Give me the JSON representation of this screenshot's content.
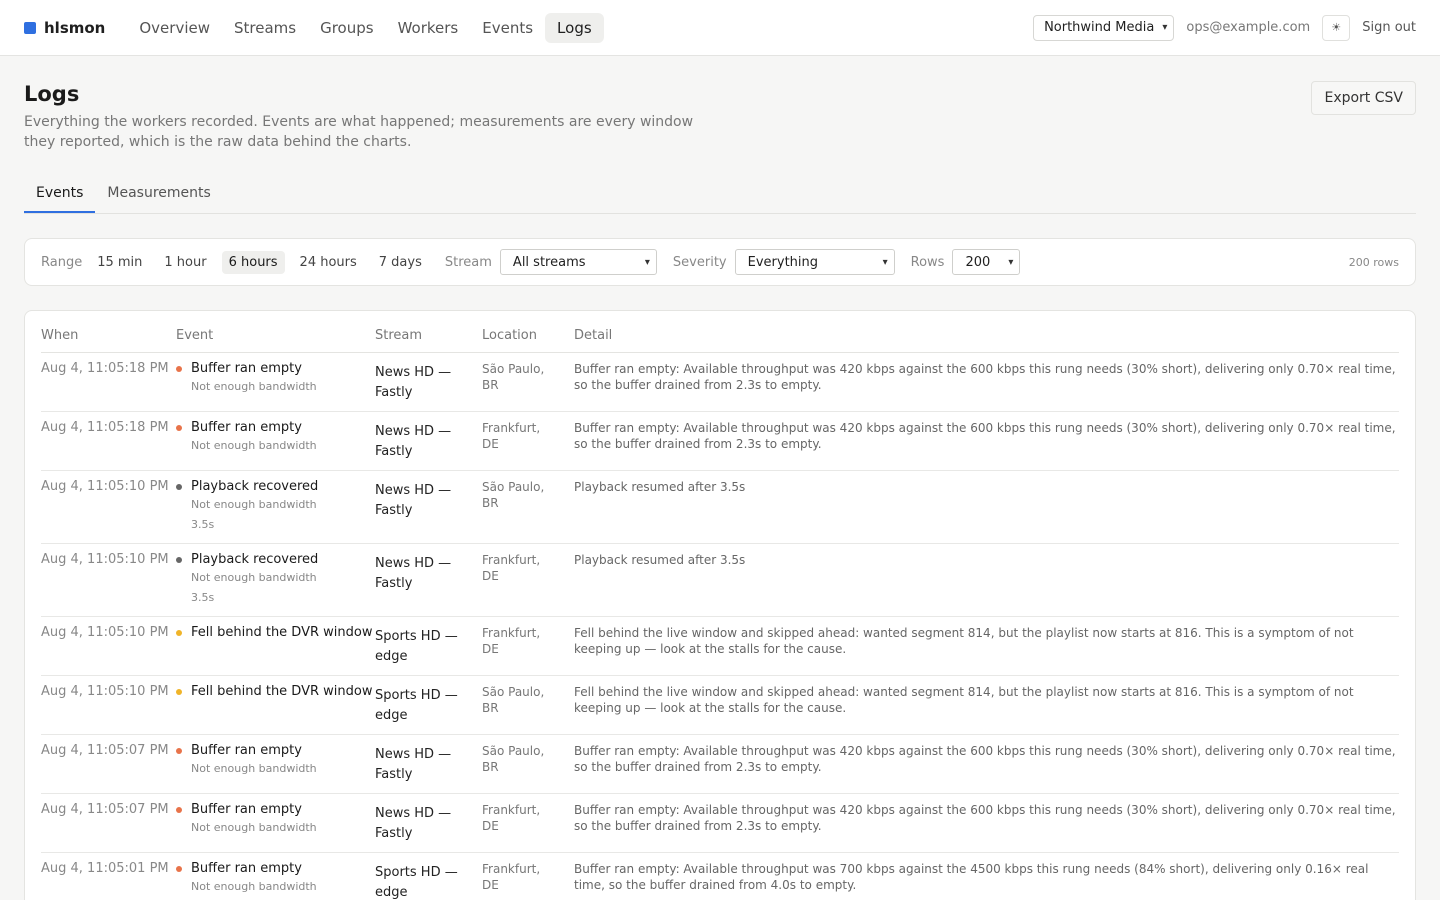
{
  "brand": {
    "name": "hlsmon",
    "color": "#2f6fe0"
  },
  "nav": [
    {
      "label": "Overview",
      "active": false
    },
    {
      "label": "Streams",
      "active": false
    },
    {
      "label": "Groups",
      "active": false
    },
    {
      "label": "Workers",
      "active": false
    },
    {
      "label": "Events",
      "active": false
    },
    {
      "label": "Logs",
      "active": true
    }
  ],
  "account": {
    "org": "Northwind Media",
    "email": "ops@example.com",
    "theme_icon": "☀",
    "signout": "Sign out"
  },
  "page": {
    "title": "Logs",
    "subtitle": "Everything the workers recorded. Events are what happened; measurements are every window they reported, which is the raw data behind the charts.",
    "export_label": "Export CSV"
  },
  "tabs": [
    {
      "label": "Events",
      "active": true
    },
    {
      "label": "Measurements",
      "active": false
    }
  ],
  "filters": {
    "range_label": "Range",
    "ranges": [
      {
        "label": "15 min",
        "active": false
      },
      {
        "label": "1 hour",
        "active": false
      },
      {
        "label": "6 hours",
        "active": true
      },
      {
        "label": "24 hours",
        "active": false
      },
      {
        "label": "7 days",
        "active": false
      }
    ],
    "stream_label": "Stream",
    "stream_value": "All streams",
    "severity_label": "Severity",
    "severity_value": "Everything",
    "rows_label": "Rows",
    "rows_value": "200",
    "rows_count": "200 rows"
  },
  "table": {
    "headers": {
      "when": "When",
      "event": "Event",
      "stream": "Stream",
      "location": "Location",
      "detail": "Detail"
    },
    "rows": [
      {
        "when": "Aug 4, 11:05:18 PM",
        "event": "Buffer ran empty",
        "dot": "#e8734a",
        "sub1": "Not enough bandwidth",
        "sub2": "",
        "stream1": "News HD —",
        "stream2": "Fastly",
        "loc1": "São Paulo,",
        "loc2": "BR",
        "detail": "Buffer ran empty: Available throughput was 420 kbps against the 600 kbps this rung needs (30% short), delivering only 0.70× real time, so the buffer drained from 2.3s to empty."
      },
      {
        "when": "Aug 4, 11:05:18 PM",
        "event": "Buffer ran empty",
        "dot": "#e8734a",
        "sub1": "Not enough bandwidth",
        "sub2": "",
        "stream1": "News HD —",
        "stream2": "Fastly",
        "loc1": "Frankfurt,",
        "loc2": "DE",
        "detail": "Buffer ran empty: Available throughput was 420 kbps against the 600 kbps this rung needs (30% short), delivering only 0.70× real time, so the buffer drained from 2.3s to empty."
      },
      {
        "when": "Aug 4, 11:05:10 PM",
        "event": "Playback recovered",
        "dot": "#666666",
        "sub1": "Not enough bandwidth",
        "sub2": "3.5s",
        "stream1": "News HD —",
        "stream2": "Fastly",
        "loc1": "São Paulo,",
        "loc2": "BR",
        "detail": "Playback resumed after 3.5s"
      },
      {
        "when": "Aug 4, 11:05:10 PM",
        "event": "Playback recovered",
        "dot": "#666666",
        "sub1": "Not enough bandwidth",
        "sub2": "3.5s",
        "stream1": "News HD —",
        "stream2": "Fastly",
        "loc1": "Frankfurt,",
        "loc2": "DE",
        "detail": "Playback resumed after 3.5s"
      },
      {
        "when": "Aug 4, 11:05:10 PM",
        "event": "Fell behind the DVR window",
        "dot": "#f0b429",
        "sub1": "",
        "sub2": "",
        "stream1": "Sports HD —",
        "stream2": "edge",
        "loc1": "Frankfurt,",
        "loc2": "DE",
        "detail": "Fell behind the live window and skipped ahead: wanted segment 814, but the playlist now starts at 816. This is a symptom of not keeping up — look at the stalls for the cause."
      },
      {
        "when": "Aug 4, 11:05:10 PM",
        "event": "Fell behind the DVR window",
        "dot": "#f0b429",
        "sub1": "",
        "sub2": "",
        "stream1": "Sports HD —",
        "stream2": "edge",
        "loc1": "São Paulo,",
        "loc2": "BR",
        "detail": "Fell behind the live window and skipped ahead: wanted segment 814, but the playlist now starts at 816. This is a symptom of not keeping up — look at the stalls for the cause."
      },
      {
        "when": "Aug 4, 11:05:07 PM",
        "event": "Buffer ran empty",
        "dot": "#e8734a",
        "sub1": "Not enough bandwidth",
        "sub2": "",
        "stream1": "News HD —",
        "stream2": "Fastly",
        "loc1": "São Paulo,",
        "loc2": "BR",
        "detail": "Buffer ran empty: Available throughput was 420 kbps against the 600 kbps this rung needs (30% short), delivering only 0.70× real time, so the buffer drained from 2.3s to empty."
      },
      {
        "when": "Aug 4, 11:05:07 PM",
        "event": "Buffer ran empty",
        "dot": "#e8734a",
        "sub1": "Not enough bandwidth",
        "sub2": "",
        "stream1": "News HD —",
        "stream2": "Fastly",
        "loc1": "Frankfurt,",
        "loc2": "DE",
        "detail": "Buffer ran empty: Available throughput was 420 kbps against the 600 kbps this rung needs (30% short), delivering only 0.70× real time, so the buffer drained from 2.3s to empty."
      },
      {
        "when": "Aug 4, 11:05:01 PM",
        "event": "Buffer ran empty",
        "dot": "#e8734a",
        "sub1": "Not enough bandwidth",
        "sub2": "",
        "stream1": "Sports HD —",
        "stream2": "edge",
        "loc1": "Frankfurt,",
        "loc2": "DE",
        "detail": "Buffer ran empty: Available throughput was 700 kbps against the 4500 kbps this rung needs (84% short), delivering only 0.16× real time, so the buffer drained from 4.0s to empty."
      }
    ]
  }
}
